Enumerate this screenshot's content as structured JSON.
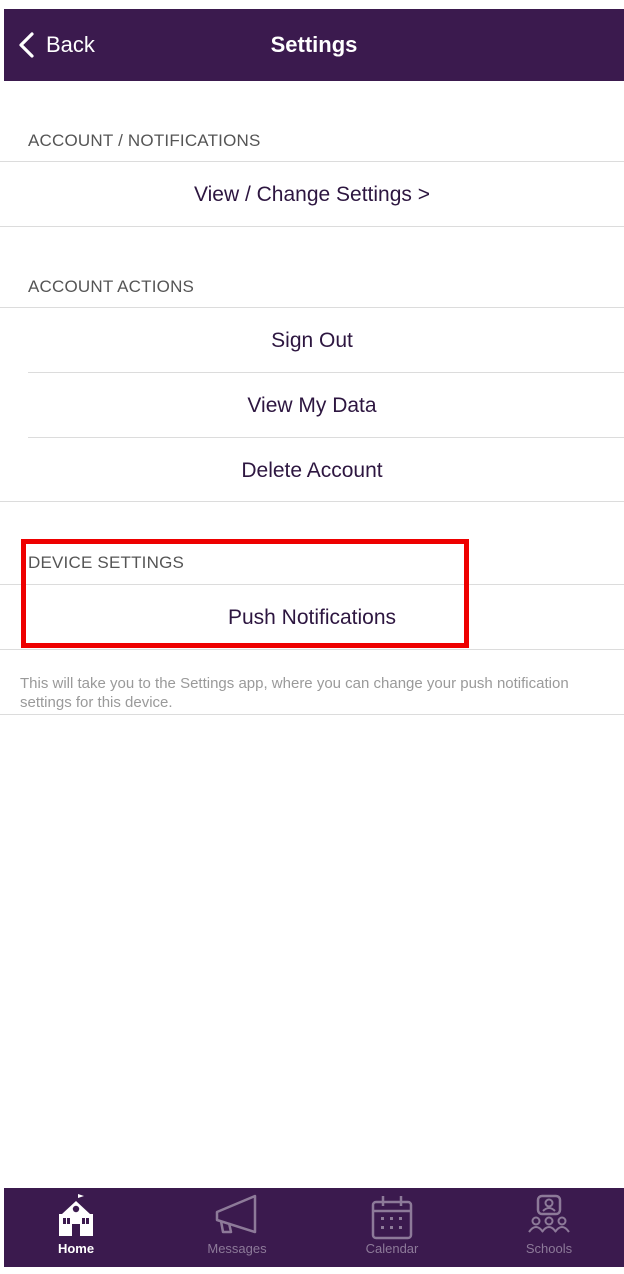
{
  "nav": {
    "back_label": "Back",
    "title": "Settings"
  },
  "sections": {
    "account_notifications": {
      "header": "ACCOUNT / NOTIFICATIONS",
      "items": [
        "View / Change Settings >"
      ]
    },
    "account_actions": {
      "header": "ACCOUNT ACTIONS",
      "items": [
        "Sign Out",
        "View My Data",
        "Delete Account"
      ]
    },
    "device_settings": {
      "header": "DEVICE SETTINGS",
      "items": [
        "Push Notifications"
      ],
      "note": "This will take you to the Settings app, where you can change your push notification settings for this device."
    }
  },
  "tabbar": {
    "tabs": [
      {
        "label": "Home",
        "icon": "school-house-icon",
        "active": true
      },
      {
        "label": "Messages",
        "icon": "megaphone-icon",
        "active": false
      },
      {
        "label": "Calendar",
        "icon": "calendar-icon",
        "active": false
      },
      {
        "label": "Schools",
        "icon": "people-icon",
        "active": false
      }
    ]
  },
  "colors": {
    "brand": "#3b1a4e",
    "highlight": "#ee0000"
  }
}
